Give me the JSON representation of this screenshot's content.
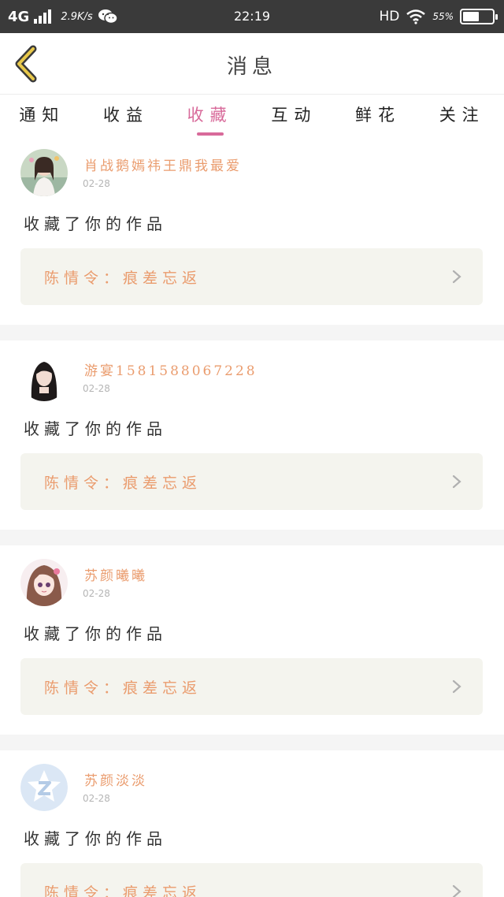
{
  "status_bar": {
    "network": "4G",
    "speed": "2.9K/s",
    "time": "22:19",
    "hd": "HD",
    "battery_text": "55%",
    "battery_level": 0.55,
    "icons": [
      "signal-icon",
      "wechat-icon",
      "wifi-icon",
      "battery-icon"
    ]
  },
  "header": {
    "title": "消息",
    "back_icon": "back-chevron-icon"
  },
  "tabs": [
    {
      "label": "通知",
      "active": false
    },
    {
      "label": "收益",
      "active": false
    },
    {
      "label": "收藏",
      "active": true
    },
    {
      "label": "互动",
      "active": false
    },
    {
      "label": "鲜花",
      "active": false
    },
    {
      "label": "关注",
      "active": false
    }
  ],
  "colors": {
    "accent": "#d86a9a",
    "name": "#ea9c6e",
    "work_bg": "#f4f4ee",
    "status_bar": "#3a3a3a"
  },
  "messages": [
    {
      "user": "肖战鹅嫣祎王鼎我最爱",
      "date": "02-28",
      "text": "收藏了你的作品",
      "work": "陈情令：痕差忘返",
      "avatar": "avatar-photo-girl"
    },
    {
      "user": "游宴15815880672​28",
      "date": "02-28",
      "text": "收藏了你的作品",
      "work": "陈情令：痕差忘返",
      "avatar": "avatar-photo-woman"
    },
    {
      "user": "苏颜曦曦",
      "date": "02-28",
      "text": "收藏了你的作品",
      "work": "陈情令：痕差忘返",
      "avatar": "avatar-anime-girl"
    },
    {
      "user": "苏颜淡淡",
      "date": "02-28",
      "text": "收藏了你的作品",
      "work": "陈情令：痕差忘返",
      "avatar": "avatar-default-z"
    }
  ]
}
